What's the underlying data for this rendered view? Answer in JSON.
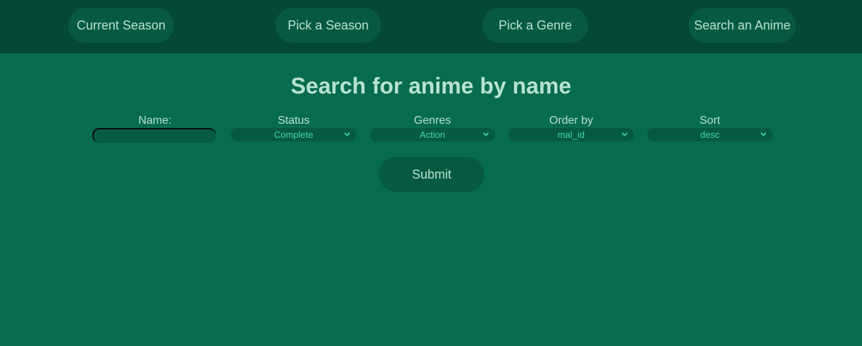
{
  "nav": {
    "items": [
      {
        "label": "Current Season"
      },
      {
        "label": "Pick a Season"
      },
      {
        "label": "Pick a Genre"
      },
      {
        "label": "Search an Anime"
      }
    ]
  },
  "page": {
    "title": "Search for anime by name"
  },
  "form": {
    "name": {
      "label": "Name:",
      "value": ""
    },
    "status": {
      "label": "Status",
      "selected": "Complete"
    },
    "genres": {
      "label": "Genres",
      "selected": "Action"
    },
    "order_by": {
      "label": "Order by",
      "selected": "mal_id"
    },
    "sort": {
      "label": "Sort",
      "selected": "desc"
    },
    "submit_label": "Submit"
  },
  "colors": {
    "background": "#076c4f",
    "navbar": "#054835",
    "button": "#075a42",
    "text": "#b8e2d0",
    "select_text": "#3ed9a0"
  },
  "icons": {
    "select_arrow": "chevron-down-icon"
  }
}
